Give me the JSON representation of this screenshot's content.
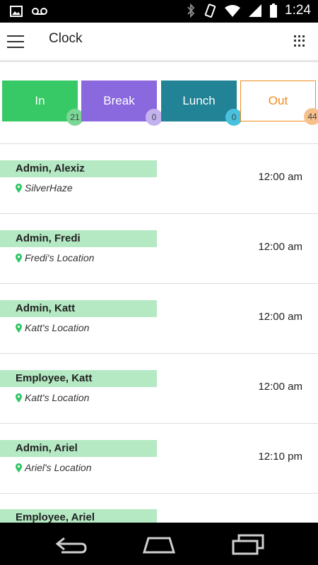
{
  "status_bar": {
    "time": "1:24"
  },
  "header": {
    "title": "Clock"
  },
  "status_buttons": [
    {
      "label": "In",
      "count": "21",
      "color": "#37c966",
      "badge_color": "#7ad796",
      "text_color": "#ffffff"
    },
    {
      "label": "Break",
      "count": "0",
      "color": "#8a68de",
      "badge_color": "#c4b2ef",
      "text_color": "#ffffff"
    },
    {
      "label": "Lunch",
      "count": "0",
      "color": "#218395",
      "badge_color": "#47c1dd",
      "text_color": "#ffffff"
    },
    {
      "label": "Out",
      "count": "44",
      "color": "#ffffff",
      "badge_color": "#f6c08a",
      "text_color": "#f08a1c"
    }
  ],
  "entries": [
    {
      "name": "Admin, Alexiz",
      "location": "SilverHaze",
      "time": "12:00 am"
    },
    {
      "name": "Admin, Fredi",
      "location": "Fredi's Location",
      "time": "12:00 am"
    },
    {
      "name": "Admin, Katt",
      "location": "Katt's Location",
      "time": "12:00 am"
    },
    {
      "name": "Employee, Katt",
      "location": "Katt's Location",
      "time": "12:00 am"
    },
    {
      "name": "Admin, Ariel",
      "location": "Ariel's Location",
      "time": "12:10 pm"
    },
    {
      "name": "Employee, Ariel",
      "location": "",
      "time": ""
    }
  ],
  "colors": {
    "name_highlight": "#b4e9c3",
    "pin": "#2fc765",
    "out_border": "#f08a1c"
  }
}
